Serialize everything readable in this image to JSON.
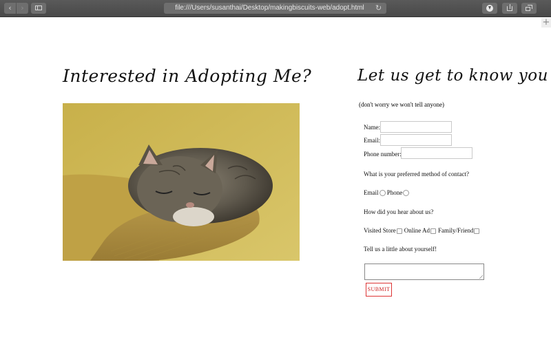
{
  "browser": {
    "url": "file:///Users/susanthai/Desktop/makingbiscuits-web/adopt.html",
    "icons": [
      "back-icon",
      "forward-icon",
      "sidebar-icon",
      "reload-icon",
      "download-icon",
      "share-icon",
      "tabs-icon",
      "new-tab-icon"
    ]
  },
  "page": {
    "left_heading": "Interested in Adopting Me?",
    "right_heading": "Let us get to know you",
    "subtitle": "(don't worry we won't tell anyone)",
    "photo": {
      "description_icon": "cat-photo"
    }
  },
  "form": {
    "name_label": "Name:",
    "email_label": "Email:",
    "phone_label": "Phone number:",
    "contact_question": "What is your preferred method of contact?",
    "contact_options": [
      "Email",
      "Phone"
    ],
    "hear_question": "How did you hear about us?",
    "hear_options": [
      "Visited Store",
      "Online Ad",
      "Family/Friend"
    ],
    "about_prompt": "Tell us a little about yourself!",
    "submit_label": "SUBMIT",
    "submit_color": "#cc2222"
  }
}
